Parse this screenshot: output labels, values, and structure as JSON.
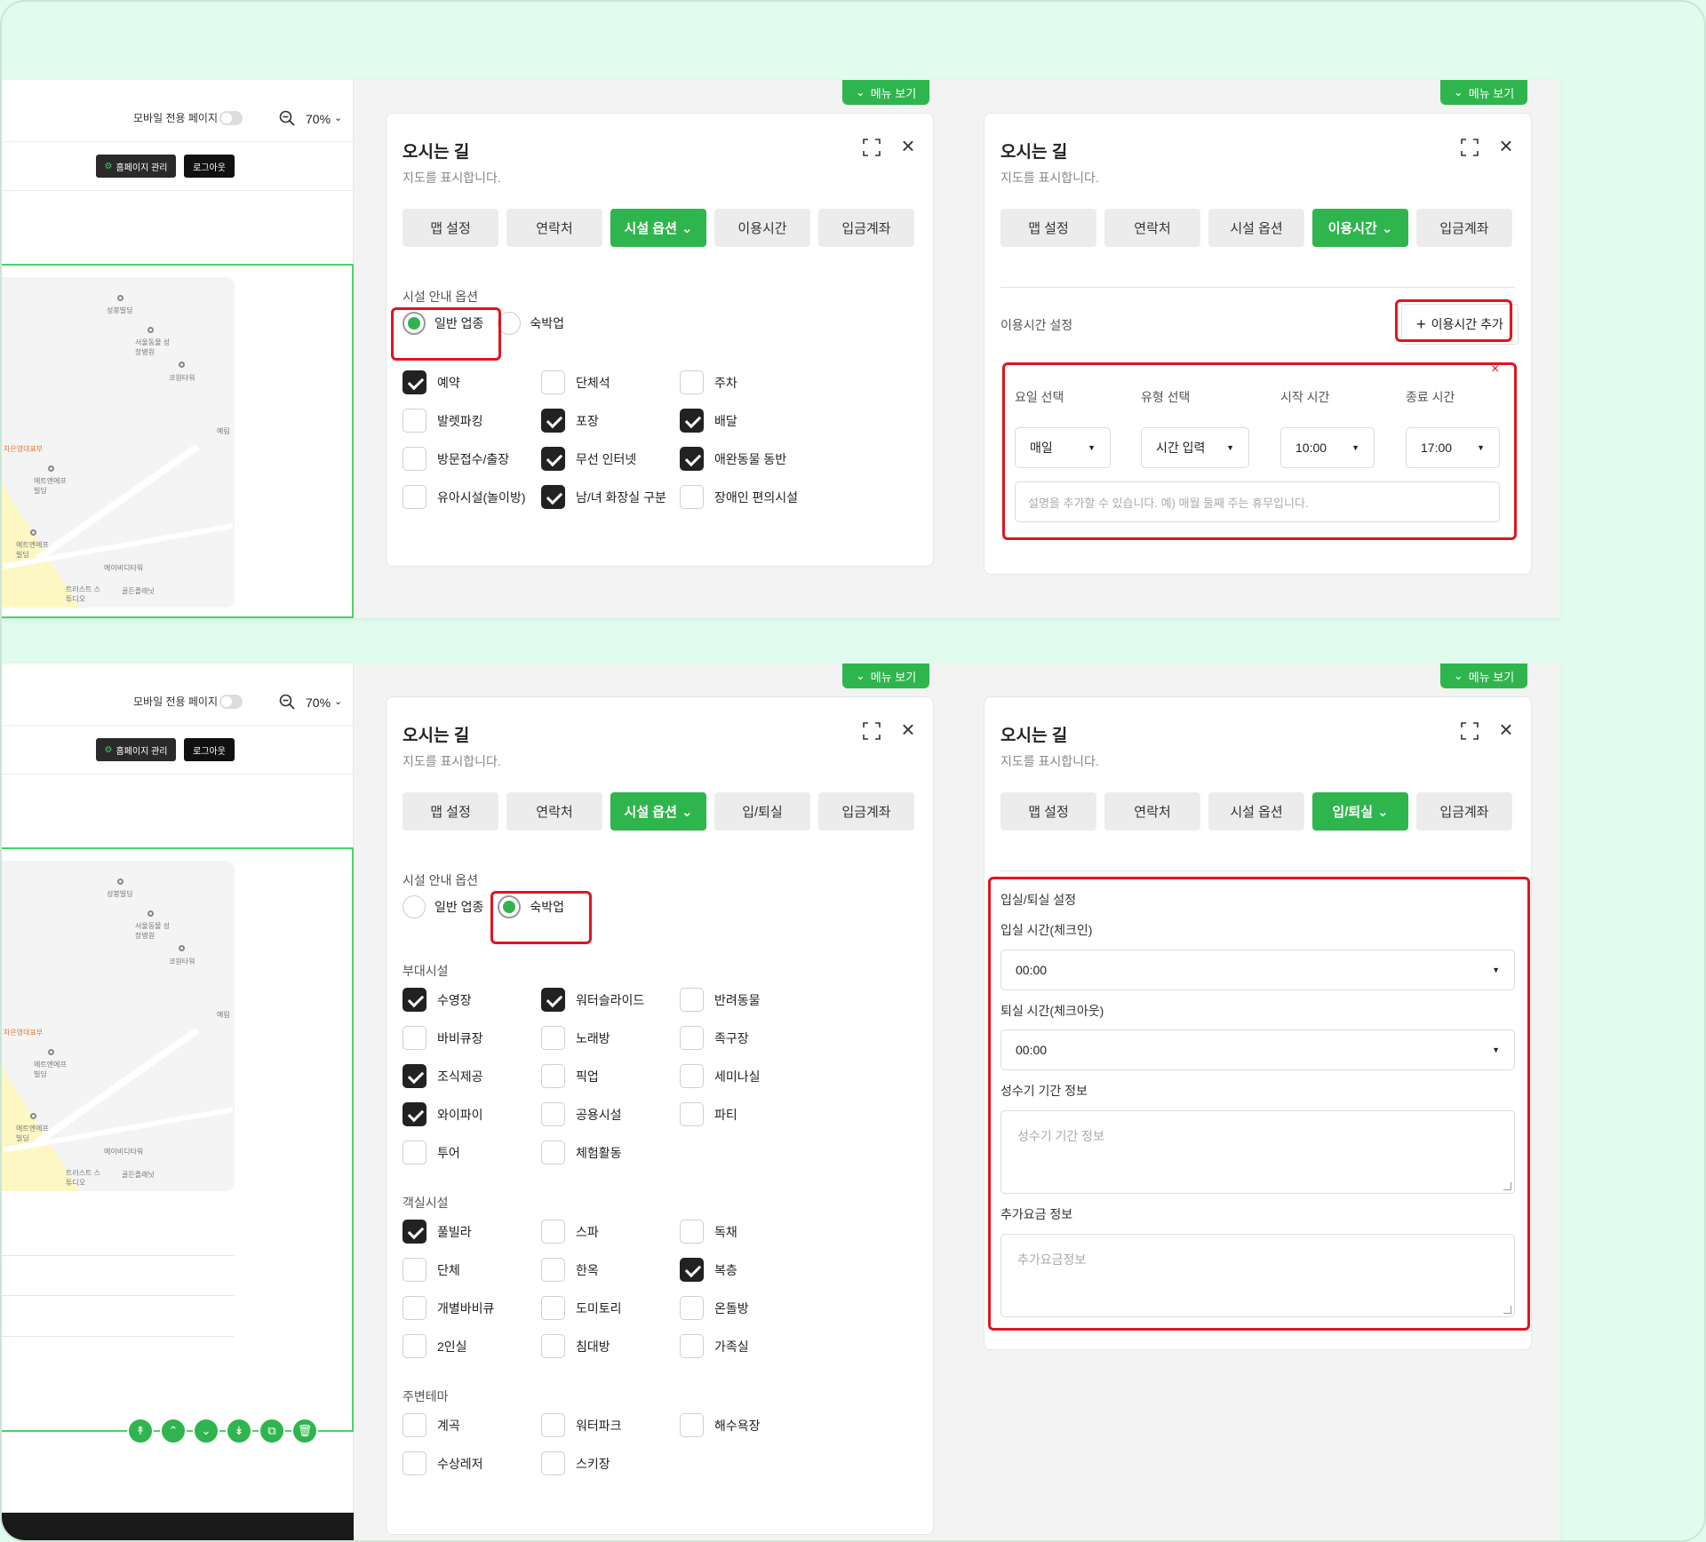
{
  "colors": {
    "accent": "#2fb54d",
    "highlight": "#e0141e",
    "background": "#e0fcef"
  },
  "left_panel": {
    "mobile_label": "모바일 전용 페이지",
    "zoom": "70%",
    "homepage_button": "홈페이지 관리",
    "logout_button": "로그아웃",
    "map_labels": {
      "l1": "성봉빌딩",
      "l2": "서울동물 성장병원",
      "l3": "코원타워",
      "l4": "차은영대표부",
      "l5": "에트엔에프 빌딩",
      "l6": "에트엔에프 빌딩",
      "l7": "에이비디타워",
      "l8": "트러스트 스튜디오",
      "l9": "골든플래닛",
      "l10": "예림"
    }
  },
  "menu_tab_label": "메뉴 보기",
  "panel": {
    "title": "오시는 길",
    "subtitle": "지도를 표시합니다."
  },
  "row1": {
    "panel_a": {
      "tabs": [
        "맵 설정",
        "연락처",
        "시설 옵션",
        "이용시간",
        "입금계좌"
      ],
      "section_label": "시설 안내 옵션",
      "radio": [
        "일반 업종",
        "숙박업"
      ],
      "checkboxes": [
        {
          "label": "예약",
          "checked": true
        },
        {
          "label": "단체석",
          "checked": false
        },
        {
          "label": "주차",
          "checked": false
        },
        {
          "label": "발렛파킹",
          "checked": false
        },
        {
          "label": "포장",
          "checked": true
        },
        {
          "label": "배달",
          "checked": true
        },
        {
          "label": "방문접수/출장",
          "checked": false
        },
        {
          "label": "무선 인터넷",
          "checked": true
        },
        {
          "label": "애완동물 동반",
          "checked": true
        },
        {
          "label": "유아시설(놀이방)",
          "checked": false
        },
        {
          "label": "남/녀 화장실 구분",
          "checked": true
        },
        {
          "label": "장애인 편의시설",
          "checked": false
        }
      ]
    },
    "panel_b": {
      "tabs": [
        "맵 설정",
        "연락처",
        "시설 옵션",
        "이용시간",
        "입금계좌"
      ],
      "section_label": "이용시간 설정",
      "add_button": "이용시간 추가",
      "fields": {
        "day_label": "요일 선택",
        "type_label": "유형 선택",
        "start_label": "시작 시간",
        "end_label": "종료 시간",
        "day_value": "매일",
        "type_value": "시간 입력",
        "start_value": "10:00",
        "end_value": "17:00",
        "desc_placeholder": "설명을 추가할 수 있습니다. 예) 매월 둘째 주는 휴무입니다."
      }
    }
  },
  "row2": {
    "panel_a": {
      "tabs": [
        "맵 설정",
        "연락처",
        "시설 옵션",
        "입/퇴실",
        "입금계좌"
      ],
      "section_label": "시설 안내 옵션",
      "radio": [
        "일반 업종",
        "숙박업"
      ],
      "group1_label": "부대시설",
      "group1": [
        {
          "label": "수영장",
          "checked": true
        },
        {
          "label": "워터슬라이드",
          "checked": true
        },
        {
          "label": "반려동물",
          "checked": false
        },
        {
          "label": "바비큐장",
          "checked": false
        },
        {
          "label": "노래방",
          "checked": false
        },
        {
          "label": "족구장",
          "checked": false
        },
        {
          "label": "조식제공",
          "checked": true
        },
        {
          "label": "픽업",
          "checked": false
        },
        {
          "label": "세미나실",
          "checked": false
        },
        {
          "label": "와이파이",
          "checked": true
        },
        {
          "label": "공용시설",
          "checked": false
        },
        {
          "label": "파티",
          "checked": false
        },
        {
          "label": "투어",
          "checked": false
        },
        {
          "label": "체험활동",
          "checked": false
        }
      ],
      "group2_label": "객실시설",
      "group2": [
        {
          "label": "풀빌라",
          "checked": true
        },
        {
          "label": "스파",
          "checked": false
        },
        {
          "label": "독채",
          "checked": false
        },
        {
          "label": "단체",
          "checked": false
        },
        {
          "label": "한옥",
          "checked": false
        },
        {
          "label": "복층",
          "checked": true
        },
        {
          "label": "개별바비큐",
          "checked": false
        },
        {
          "label": "도미토리",
          "checked": false
        },
        {
          "label": "온돌방",
          "checked": false
        },
        {
          "label": "2인실",
          "checked": false
        },
        {
          "label": "침대방",
          "checked": false
        },
        {
          "label": "가족실",
          "checked": false
        }
      ],
      "group3_label": "주변테마",
      "group3": [
        {
          "label": "계곡",
          "checked": false
        },
        {
          "label": "워터파크",
          "checked": false
        },
        {
          "label": "해수욕장",
          "checked": false
        },
        {
          "label": "수상레저",
          "checked": false
        },
        {
          "label": "스키장",
          "checked": false
        }
      ]
    },
    "panel_b": {
      "tabs": [
        "맵 설정",
        "연락처",
        "시설 옵션",
        "입/퇴실",
        "입금계좌"
      ],
      "section_label": "입실/퇴실 설정",
      "checkin_label": "입실 시간(체크인)",
      "checkin_value": "00:00",
      "checkout_label": "퇴실 시간(체크아웃)",
      "checkout_value": "00:00",
      "peak_label": "성수기 기간 정보",
      "peak_placeholder": "성수기 기간 정보",
      "extra_label": "추가요금 정보",
      "extra_placeholder": "추가요금정보"
    }
  }
}
